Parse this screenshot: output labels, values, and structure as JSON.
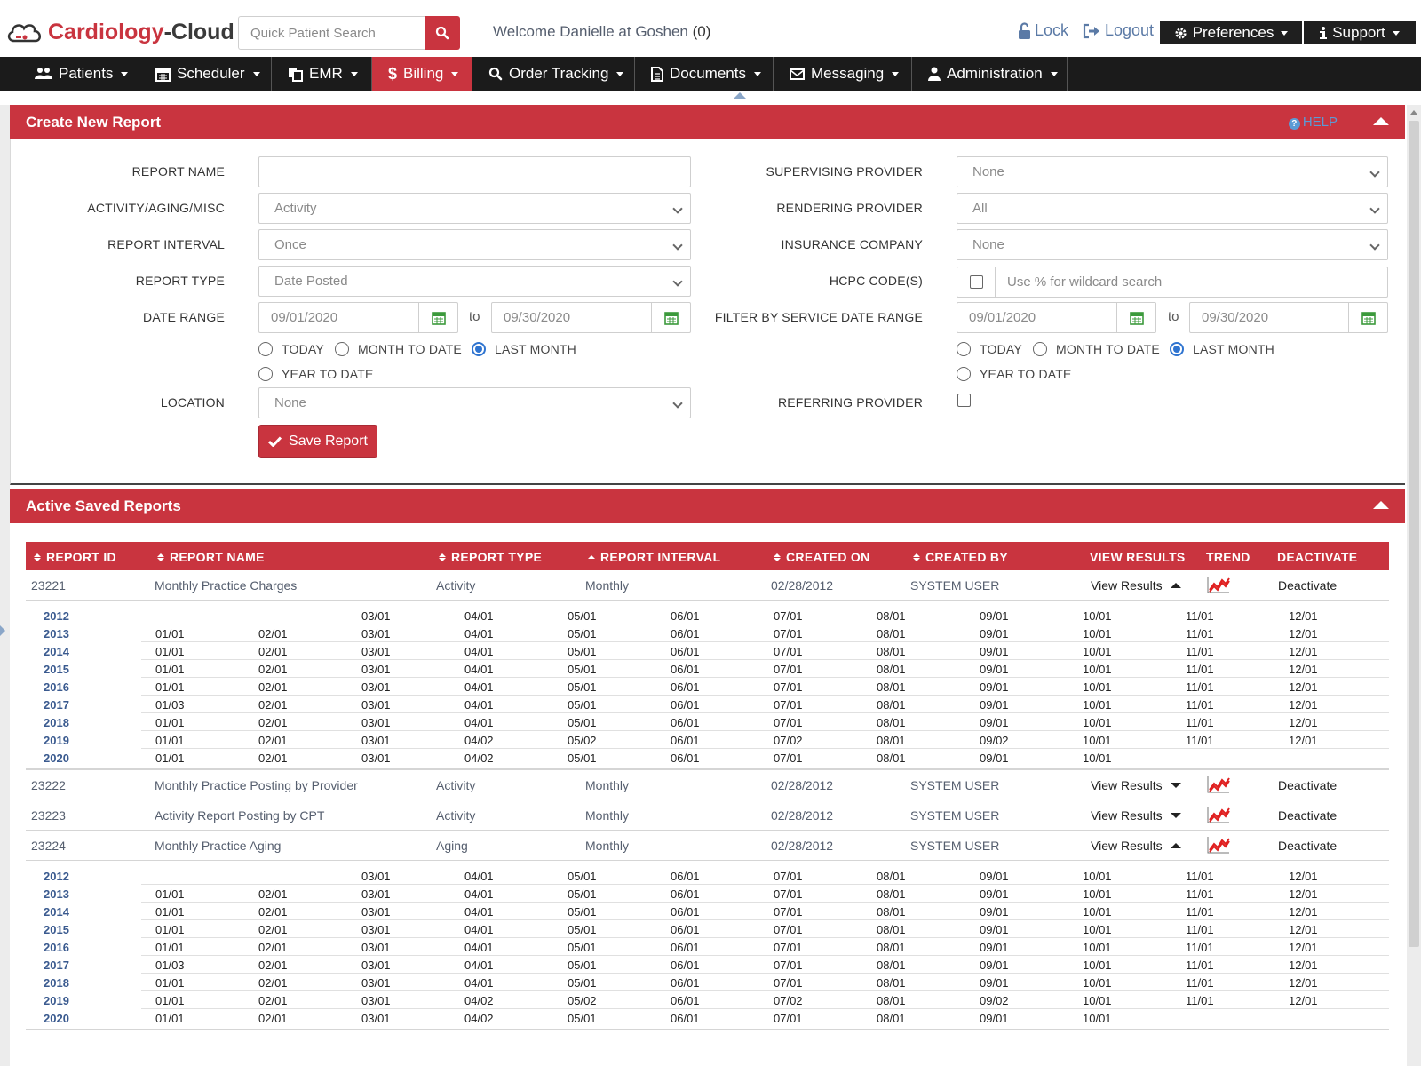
{
  "header": {
    "logo_part1": "Cardiology",
    "logo_sep": "-",
    "logo_part2": "Cloud",
    "search_placeholder": "Quick Patient Search",
    "welcome": "Welcome Danielle at Goshen",
    "welcome_count": "(0)",
    "lock": "Lock",
    "logout": "Logout",
    "preferences": "Preferences",
    "support": "Support"
  },
  "nav": {
    "items": [
      {
        "label": "Patients",
        "icon": "users-icon"
      },
      {
        "label": "Scheduler",
        "icon": "calendar-icon"
      },
      {
        "label": "EMR",
        "icon": "copy-icon"
      },
      {
        "label": "Billing",
        "icon": "dollar-icon"
      },
      {
        "label": "Order Tracking",
        "icon": "search-icon"
      },
      {
        "label": "Documents",
        "icon": "document-icon"
      },
      {
        "label": "Messaging",
        "icon": "envelope-icon"
      },
      {
        "label": "Administration",
        "icon": "user-icon"
      }
    ],
    "active": "Billing"
  },
  "create_panel": {
    "title": "Create New Report",
    "help": "HELP",
    "labels": {
      "report_name": "REPORT NAME",
      "activity": "ACTIVITY/AGING/MISC",
      "interval": "REPORT INTERVAL",
      "type": "REPORT TYPE",
      "date_range": "DATE RANGE",
      "location": "LOCATION",
      "supervising": "SUPERVISING PROVIDER",
      "rendering": "RENDERING PROVIDER",
      "insurance": "INSURANCE COMPANY",
      "hcpc": "HCPC CODE(S)",
      "filter_service": "FILTER BY SERVICE DATE RANGE",
      "referring": "REFERRING PROVIDER"
    },
    "values": {
      "report_name": "",
      "activity": "Activity",
      "interval": "Once",
      "type": "Date Posted",
      "date_from": "09/01/2020",
      "date_to": "09/30/2020",
      "location": "None",
      "supervising": "None",
      "rendering": "All",
      "insurance": "None",
      "hcpc_placeholder": "Use % for wildcard search",
      "svc_from": "09/01/2020",
      "svc_to": "09/30/2020"
    },
    "to": "to",
    "radios": {
      "today": "TODAY",
      "mtd": "MONTH TO DATE",
      "last_month": "LAST MONTH",
      "ytd": "YEAR TO DATE"
    },
    "save": "Save Report"
  },
  "saved_panel": {
    "title": "Active Saved Reports",
    "columns": [
      "REPORT ID",
      "REPORT NAME",
      "REPORT TYPE",
      "REPORT INTERVAL",
      "CREATED ON",
      "CREATED BY",
      "VIEW RESULTS",
      "TREND",
      "DEACTIVATE"
    ],
    "rows": [
      {
        "id": "23221",
        "name": "Monthly Practice Charges",
        "type": "Activity",
        "interval": "Monthly",
        "created_on": "02/28/2012",
        "created_by": "SYSTEM USER",
        "view": "View Results",
        "expanded": true,
        "deactivate": "Deactivate"
      },
      {
        "id": "23222",
        "name": "Monthly Practice Posting by Provider",
        "type": "Activity",
        "interval": "Monthly",
        "created_on": "02/28/2012",
        "created_by": "SYSTEM USER",
        "view": "View Results",
        "expanded": false,
        "deactivate": "Deactivate"
      },
      {
        "id": "23223",
        "name": "Activity Report Posting by CPT",
        "type": "Activity",
        "interval": "Monthly",
        "created_on": "02/28/2012",
        "created_by": "SYSTEM USER",
        "view": "View Results",
        "expanded": false,
        "deactivate": "Deactivate"
      },
      {
        "id": "23224",
        "name": "Monthly Practice Aging",
        "type": "Aging",
        "interval": "Monthly",
        "created_on": "02/28/2012",
        "created_by": "SYSTEM USER",
        "view": "View Results",
        "expanded": true,
        "deactivate": "Deactivate"
      }
    ],
    "results_1": [
      {
        "year": "2012",
        "dates": [
          "",
          "",
          "03/01",
          "04/01",
          "05/01",
          "06/01",
          "07/01",
          "08/01",
          "09/01",
          "10/01",
          "11/01",
          "12/01"
        ]
      },
      {
        "year": "2013",
        "dates": [
          "01/01",
          "02/01",
          "03/01",
          "04/01",
          "05/01",
          "06/01",
          "07/01",
          "08/01",
          "09/01",
          "10/01",
          "11/01",
          "12/01"
        ]
      },
      {
        "year": "2014",
        "dates": [
          "01/01",
          "02/01",
          "03/01",
          "04/01",
          "05/01",
          "06/01",
          "07/01",
          "08/01",
          "09/01",
          "10/01",
          "11/01",
          "12/01"
        ]
      },
      {
        "year": "2015",
        "dates": [
          "01/01",
          "02/01",
          "03/01",
          "04/01",
          "05/01",
          "06/01",
          "07/01",
          "08/01",
          "09/01",
          "10/01",
          "11/01",
          "12/01"
        ]
      },
      {
        "year": "2016",
        "dates": [
          "01/01",
          "02/01",
          "03/01",
          "04/01",
          "05/01",
          "06/01",
          "07/01",
          "08/01",
          "09/01",
          "10/01",
          "11/01",
          "12/01"
        ]
      },
      {
        "year": "2017",
        "dates": [
          "01/03",
          "02/01",
          "03/01",
          "04/01",
          "05/01",
          "06/01",
          "07/01",
          "08/01",
          "09/01",
          "10/01",
          "11/01",
          "12/01"
        ]
      },
      {
        "year": "2018",
        "dates": [
          "01/01",
          "02/01",
          "03/01",
          "04/01",
          "05/01",
          "06/01",
          "07/01",
          "08/01",
          "09/01",
          "10/01",
          "11/01",
          "12/01"
        ]
      },
      {
        "year": "2019",
        "dates": [
          "01/01",
          "02/01",
          "03/01",
          "04/02",
          "05/02",
          "06/01",
          "07/02",
          "08/01",
          "09/02",
          "10/01",
          "11/01",
          "12/01"
        ]
      },
      {
        "year": "2020",
        "dates": [
          "01/01",
          "02/01",
          "03/01",
          "04/02",
          "05/01",
          "06/01",
          "07/01",
          "08/01",
          "09/01",
          "10/01",
          "",
          ""
        ]
      }
    ],
    "results_2": [
      {
        "year": "2012",
        "dates": [
          "",
          "",
          "03/01",
          "04/01",
          "05/01",
          "06/01",
          "07/01",
          "08/01",
          "09/01",
          "10/01",
          "11/01",
          "12/01"
        ]
      },
      {
        "year": "2013",
        "dates": [
          "01/01",
          "02/01",
          "03/01",
          "04/01",
          "05/01",
          "06/01",
          "07/01",
          "08/01",
          "09/01",
          "10/01",
          "11/01",
          "12/01"
        ]
      },
      {
        "year": "2014",
        "dates": [
          "01/01",
          "02/01",
          "03/01",
          "04/01",
          "05/01",
          "06/01",
          "07/01",
          "08/01",
          "09/01",
          "10/01",
          "11/01",
          "12/01"
        ]
      },
      {
        "year": "2015",
        "dates": [
          "01/01",
          "02/01",
          "03/01",
          "04/01",
          "05/01",
          "06/01",
          "07/01",
          "08/01",
          "09/01",
          "10/01",
          "11/01",
          "12/01"
        ]
      },
      {
        "year": "2016",
        "dates": [
          "01/01",
          "02/01",
          "03/01",
          "04/01",
          "05/01",
          "06/01",
          "07/01",
          "08/01",
          "09/01",
          "10/01",
          "11/01",
          "12/01"
        ]
      },
      {
        "year": "2017",
        "dates": [
          "01/03",
          "02/01",
          "03/01",
          "04/01",
          "05/01",
          "06/01",
          "07/01",
          "08/01",
          "09/01",
          "10/01",
          "11/01",
          "12/01"
        ]
      },
      {
        "year": "2018",
        "dates": [
          "01/01",
          "02/01",
          "03/01",
          "04/01",
          "05/01",
          "06/01",
          "07/01",
          "08/01",
          "09/01",
          "10/01",
          "11/01",
          "12/01"
        ]
      },
      {
        "year": "2019",
        "dates": [
          "01/01",
          "02/01",
          "03/01",
          "04/02",
          "05/02",
          "06/01",
          "07/02",
          "08/01",
          "09/02",
          "10/01",
          "11/01",
          "12/01"
        ]
      },
      {
        "year": "2020",
        "dates": [
          "01/01",
          "02/01",
          "03/01",
          "04/02",
          "05/01",
          "06/01",
          "07/01",
          "08/01",
          "09/01",
          "10/01",
          "",
          ""
        ]
      }
    ]
  },
  "colors": {
    "brand_red": "#c9343f",
    "nav_dark": "#1b1b1b",
    "link_blue": "#5b7aa6",
    "radio_blue": "#2f74d0"
  }
}
